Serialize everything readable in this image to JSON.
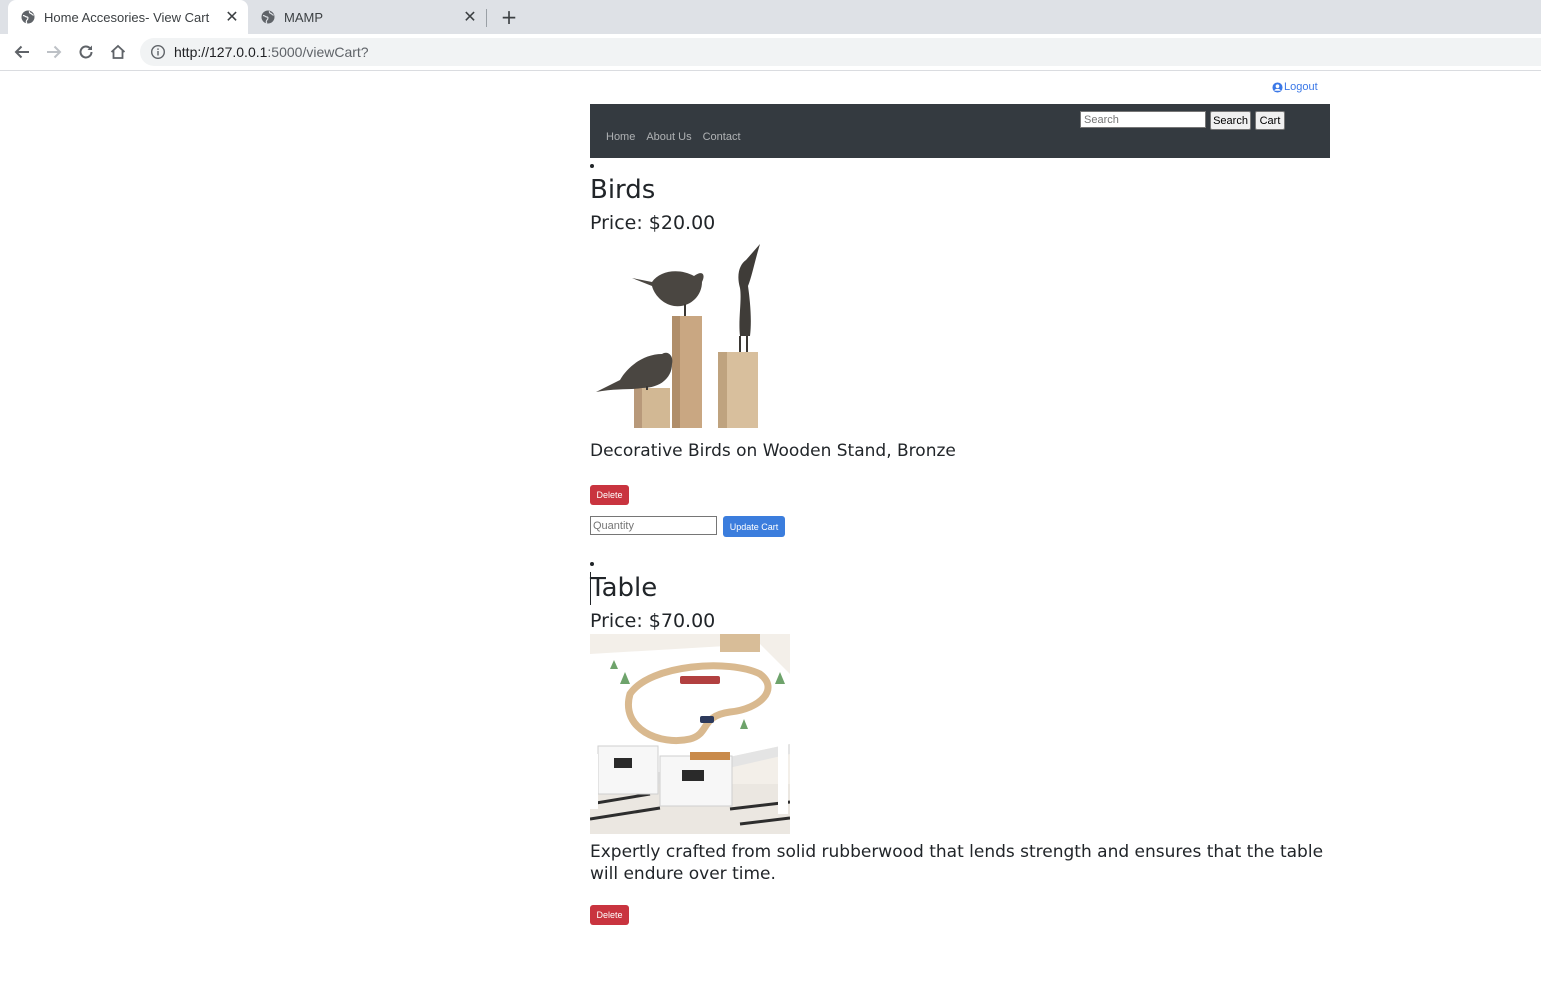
{
  "browser": {
    "tabs": [
      {
        "title": "Home Accesories- View Cart",
        "active": true,
        "icon": "globe-icon"
      },
      {
        "title": "MAMP",
        "active": false,
        "icon": "globe-icon"
      }
    ],
    "new_tab": "+",
    "close_glyph": "✕",
    "url_host": "http://127.0.0.1",
    "url_rest": ":5000/viewCart?"
  },
  "header": {
    "logout_label": "Logout"
  },
  "navbar": {
    "links": [
      "Home",
      "About Us",
      "Contact"
    ],
    "search_placeholder": "Search",
    "search_button": "Search",
    "cart_button": "Cart"
  },
  "cart": {
    "items": [
      {
        "name": "Birds",
        "price": "Price: $20.00",
        "description": "Decorative Birds on Wooden Stand, Bronze",
        "delete_label": "Delete",
        "quantity_placeholder": "Quantity",
        "update_label": "Update Cart"
      },
      {
        "name": "Table",
        "price": "Price: $70.00",
        "description": "Expertly crafted from solid rubberwood that lends strength and ensures that the table will endure over time.",
        "delete_label": "Delete"
      }
    ]
  },
  "colors": {
    "navbar_bg": "#343a40",
    "delete_bg": "#c9343f",
    "update_bg": "#3b7ddd",
    "logout_link": "#3b78e7"
  }
}
